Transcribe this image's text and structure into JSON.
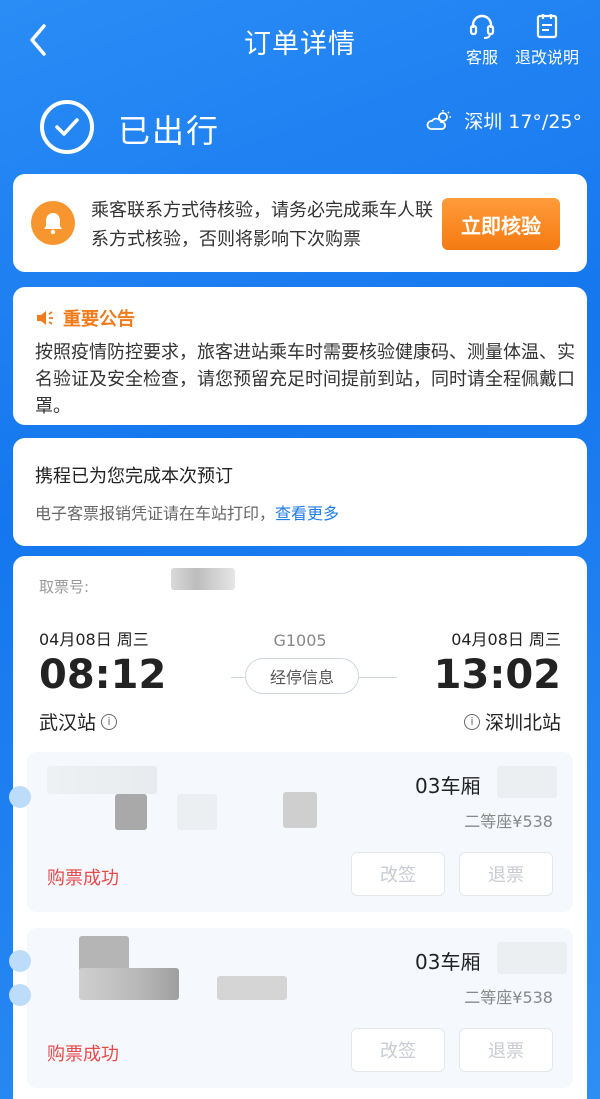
{
  "header": {
    "title": "订单详情",
    "service_label": "客服",
    "rules_label": "退改说明"
  },
  "status": {
    "text": "已出行",
    "weather": "深圳 17°/25°"
  },
  "verify": {
    "message": "乘客联系方式待核验，请务必完成乘车人联系方式核验，否则将影响下次购票",
    "button": "立即核验"
  },
  "notice": {
    "title": "重要公告",
    "body": "按照疫情防控要求，旅客进站乘车时需要核验健康码、测量体温、实名验证及安全检查，请您预留充足时间提前到站，同时请全程佩戴口罩。"
  },
  "booked": {
    "title": "携程已为您完成本次预订",
    "sub": "电子客票报销凭证请在车站打印，",
    "link": "查看更多"
  },
  "ticket": {
    "pickup_label": "取票号:",
    "dep_date": "04月08日  周三",
    "arr_date": "04月08日  周三",
    "train_no": "G1005",
    "dep_time": "08:12",
    "arr_time": "13:02",
    "stops_label": "经停信息",
    "dep_station": "武汉站",
    "arr_station": "深圳北站",
    "info_glyph": "i",
    "passengers": [
      {
        "coach": "03车厢",
        "seat": "二等座¥538",
        "status": "购票成功",
        "change": "改签",
        "refund": "退票"
      },
      {
        "coach": "03车厢",
        "seat": "二等座¥538",
        "status": "购票成功",
        "change": "改签",
        "refund": "退票"
      }
    ]
  },
  "colors": {
    "brand_blue": "#1f7ee6",
    "accent_orange": "#f57a12",
    "success_red": "#e84a4a"
  },
  "icons": [
    "back-icon",
    "headset-icon",
    "document-icon",
    "check-circle-icon",
    "weather-icon",
    "bell-icon",
    "speaker-icon",
    "info-icon"
  ]
}
